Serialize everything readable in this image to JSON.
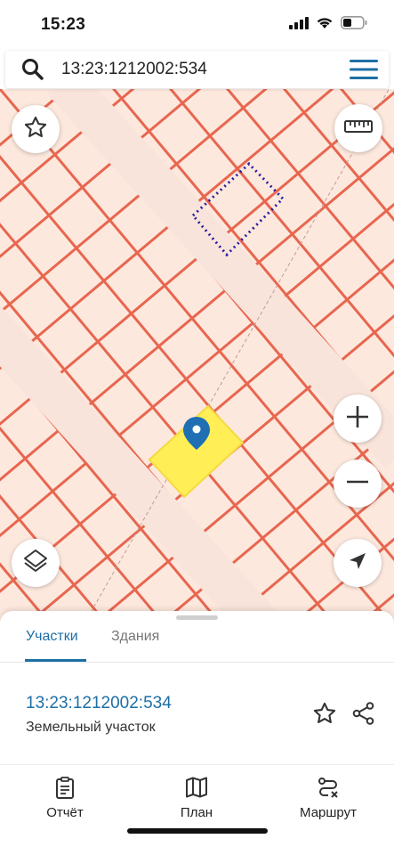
{
  "status": {
    "time": "15:23"
  },
  "search": {
    "query": "13:23:1212002:534"
  },
  "tabs": [
    {
      "label": "Участки",
      "active": true
    },
    {
      "label": "Здания",
      "active": false
    }
  ],
  "parcel": {
    "number": "13:23:1212002:534",
    "type": "Земельный участок"
  },
  "bottom_nav": [
    {
      "label": "Отчёт",
      "icon": "report-icon"
    },
    {
      "label": "План",
      "icon": "map-icon"
    },
    {
      "label": "Маршрут",
      "icon": "route-icon"
    }
  ],
  "colors": {
    "accent": "#1d6fa5",
    "map_background": "#fde8dd",
    "parcel_border": "#e8664f",
    "selected_parcel": "#ffee55",
    "highlight_outline": "#2a1fa0"
  }
}
